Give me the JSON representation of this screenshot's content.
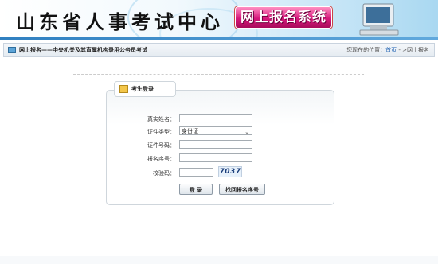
{
  "banner": {
    "site_title": "山东省人事考试中心",
    "system_title": "网上报名系统"
  },
  "breadcrumb": {
    "title": "网上报名——中央机关及其直属机构录用公务员考试",
    "location_prefix": "您现在的位置：",
    "home_link": "首页",
    "separator": " - >",
    "current": "网上报名"
  },
  "login": {
    "tab_title": "考生登录",
    "fields": {
      "real_name_label": "真实姓名：",
      "real_name_value": "",
      "id_type_label": "证件类型：",
      "id_type_selected": "身份证",
      "id_number_label": "证件号码：",
      "id_number_value": "",
      "reg_number_label": "报名序号：",
      "reg_number_value": "",
      "captcha_label": "校验码：",
      "captcha_value": "",
      "captcha_image_text": "7037"
    },
    "buttons": {
      "login": "登 录",
      "recover": "找回报名序号"
    }
  },
  "colors": {
    "accent_blue": "#2f7fc0",
    "system_title_magenta": "#d6177b",
    "link_blue": "#1b5fb0"
  },
  "icons": {
    "crumb": "window-icon",
    "tab": "user-card-icon",
    "select": "chevron-down-icon"
  }
}
